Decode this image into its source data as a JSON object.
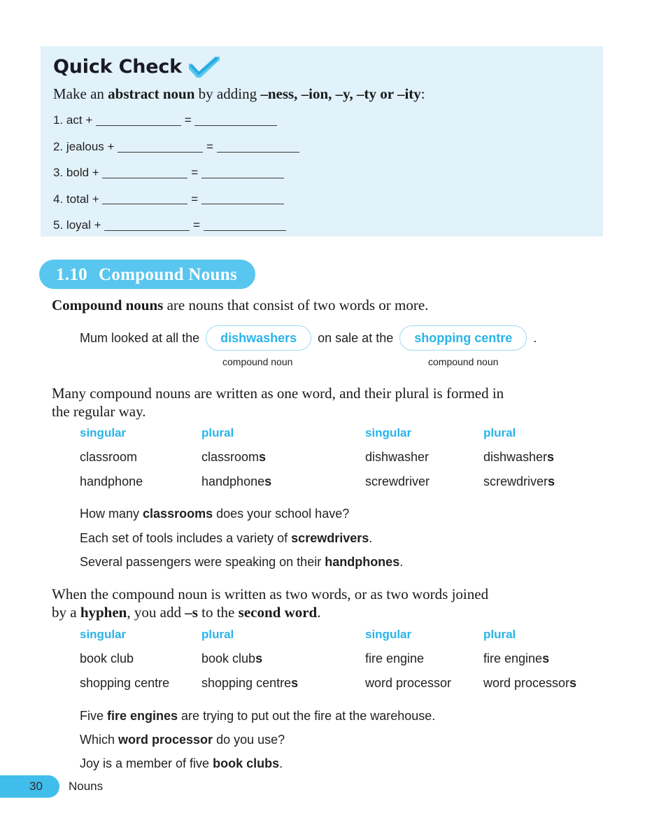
{
  "quick_check": {
    "title": "Quick Check",
    "check_icon": "check-mark-icon",
    "instruction_prefix": "Make an ",
    "instruction_bold": "abstract noun",
    "instruction_mid": " by adding ",
    "instruction_suffixes": "–ness, –ion, –y, –ty or –ity",
    "instruction_end": ":",
    "items": [
      {
        "num": "1.",
        "word": "act",
        "plus": "+",
        "equals": "="
      },
      {
        "num": "2.",
        "word": "jealous",
        "plus": "+",
        "equals": "="
      },
      {
        "num": "3.",
        "word": "bold",
        "plus": "+",
        "equals": "="
      },
      {
        "num": "4.",
        "word": "total",
        "plus": "+",
        "equals": "="
      },
      {
        "num": "5.",
        "word": "loyal",
        "plus": "+",
        "equals": "="
      }
    ]
  },
  "section": {
    "number": "1.10",
    "title": "Compound Nouns"
  },
  "intro": {
    "bold": "Compound nouns",
    "rest": " are nouns that consist of  two words or more."
  },
  "example_sentence": {
    "part1": "Mum looked at all the",
    "pill1": "dishwashers",
    "part2": "on sale at the",
    "pill2": "shopping centre",
    "part3": ".",
    "caption1": "compound noun",
    "caption2": "compound noun"
  },
  "para_one_word": {
    "line1": "Many compound nouns are written as one word, and their plural is formed in",
    "line2": "the regular way."
  },
  "table_one_word": {
    "headers": [
      "singular",
      "plural",
      "singular",
      "plural"
    ],
    "rows": [
      {
        "c1": "classroom",
        "c2_stem": "classroom",
        "c2_s": "s",
        "c3": "dishwasher",
        "c4_stem": "dishwasher",
        "c4_s": "s"
      },
      {
        "c1": "handphone",
        "c2_stem": "handphone",
        "c2_s": "s",
        "c3": "screwdriver",
        "c4_stem": "screwdriver",
        "c4_s": "s"
      }
    ]
  },
  "examples_one_word": [
    {
      "pre": "How many ",
      "bold": "classrooms",
      "post": " does your school have?"
    },
    {
      "pre": "Each set of tools includes a variety of ",
      "bold": "screwdrivers",
      "post": "."
    },
    {
      "pre": "Several passengers were speaking on their ",
      "bold": "handphones",
      "post": "."
    }
  ],
  "para_two_words": {
    "line1_a": "When the compound noun is written as two words, or as two words joined",
    "line2_a": "by a ",
    "line2_b": "hyphen",
    "line2_c": ", you add ",
    "line2_d": "–s",
    "line2_e": " to the ",
    "line2_f": "second word",
    "line2_g": "."
  },
  "table_two_words": {
    "headers": [
      "singular",
      "plural",
      "singular",
      "plural"
    ],
    "rows": [
      {
        "c1": "book club",
        "c2_stem": "book club",
        "c2_s": "s",
        "c3": "fire engine",
        "c4_stem": "fire engine",
        "c4_s": "s"
      },
      {
        "c1": "shopping centre",
        "c2_stem": "shopping centre",
        "c2_s": "s",
        "c3": "word processor",
        "c4_stem": "word processor",
        "c4_s": "s"
      }
    ]
  },
  "examples_two_words": [
    {
      "pre": "Five ",
      "bold": "fire engines",
      "post": " are trying to put out the fire at the warehouse."
    },
    {
      "pre": "Which ",
      "bold": "word processor",
      "post": " do you use?"
    },
    {
      "pre": "Joy is a member of five ",
      "bold": "book clubs",
      "post": "."
    }
  ],
  "footer": {
    "page_number": "30",
    "chapter_label": "Nouns"
  },
  "colors": {
    "panel_bg": "#e1f2fa",
    "badge_bg": "#59c6ef",
    "accent_cyan": "#29b4e8",
    "pill_border": "#9bdcf4",
    "footer_pill": "#41bdec",
    "text": "#231f20"
  }
}
